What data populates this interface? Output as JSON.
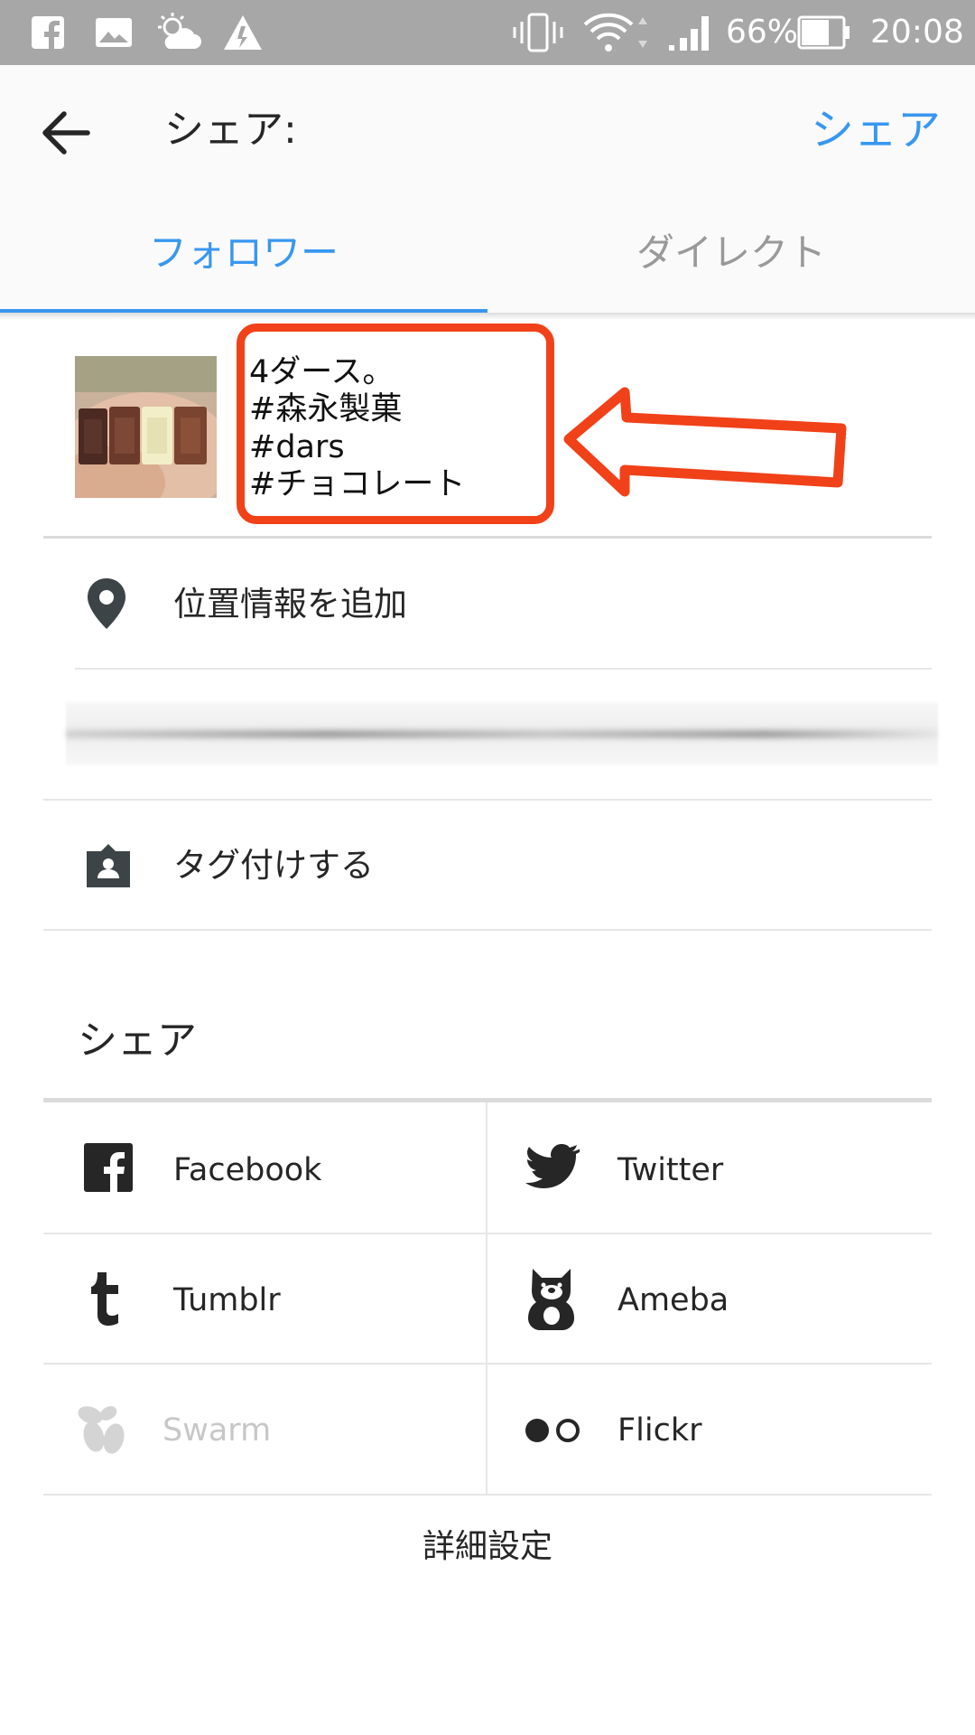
{
  "status_bar": {
    "battery": "66%",
    "time": "20:08",
    "icons": [
      "facebook-icon",
      "image-icon",
      "weather-icon",
      "warning-icon",
      "vibrate-icon",
      "wifi-icon",
      "signal-icon",
      "battery-icon"
    ]
  },
  "header": {
    "back_icon": "arrow-back-icon",
    "title": "シェア:",
    "share_button": "シェア"
  },
  "tabs": [
    {
      "label": "フォロワー",
      "active": true
    },
    {
      "label": "ダイレクト",
      "active": false
    }
  ],
  "caption": {
    "lines": [
      "4ダース。",
      "#森永製菓",
      "#dars",
      "#チョコレート"
    ]
  },
  "location": {
    "label": "位置情報を追加",
    "icon": "location-pin-icon"
  },
  "tag_people": {
    "label": "タグ付けする",
    "icon": "person-tag-icon"
  },
  "share_section": {
    "title": "シェア",
    "services": [
      {
        "label": "Facebook",
        "icon": "facebook-icon",
        "enabled": true
      },
      {
        "label": "Twitter",
        "icon": "twitter-icon",
        "enabled": true
      },
      {
        "label": "Tumblr",
        "icon": "tumblr-icon",
        "enabled": true
      },
      {
        "label": "Ameba",
        "icon": "ameba-icon",
        "enabled": true
      },
      {
        "label": "Swarm",
        "icon": "swarm-icon",
        "enabled": false
      },
      {
        "label": "Flickr",
        "icon": "flickr-icon",
        "enabled": true
      }
    ]
  },
  "advanced_settings": "詳細設定",
  "colors": {
    "accent": "#3897f0",
    "annotation": "#f04119",
    "status_bar": "#a7a7a7"
  }
}
